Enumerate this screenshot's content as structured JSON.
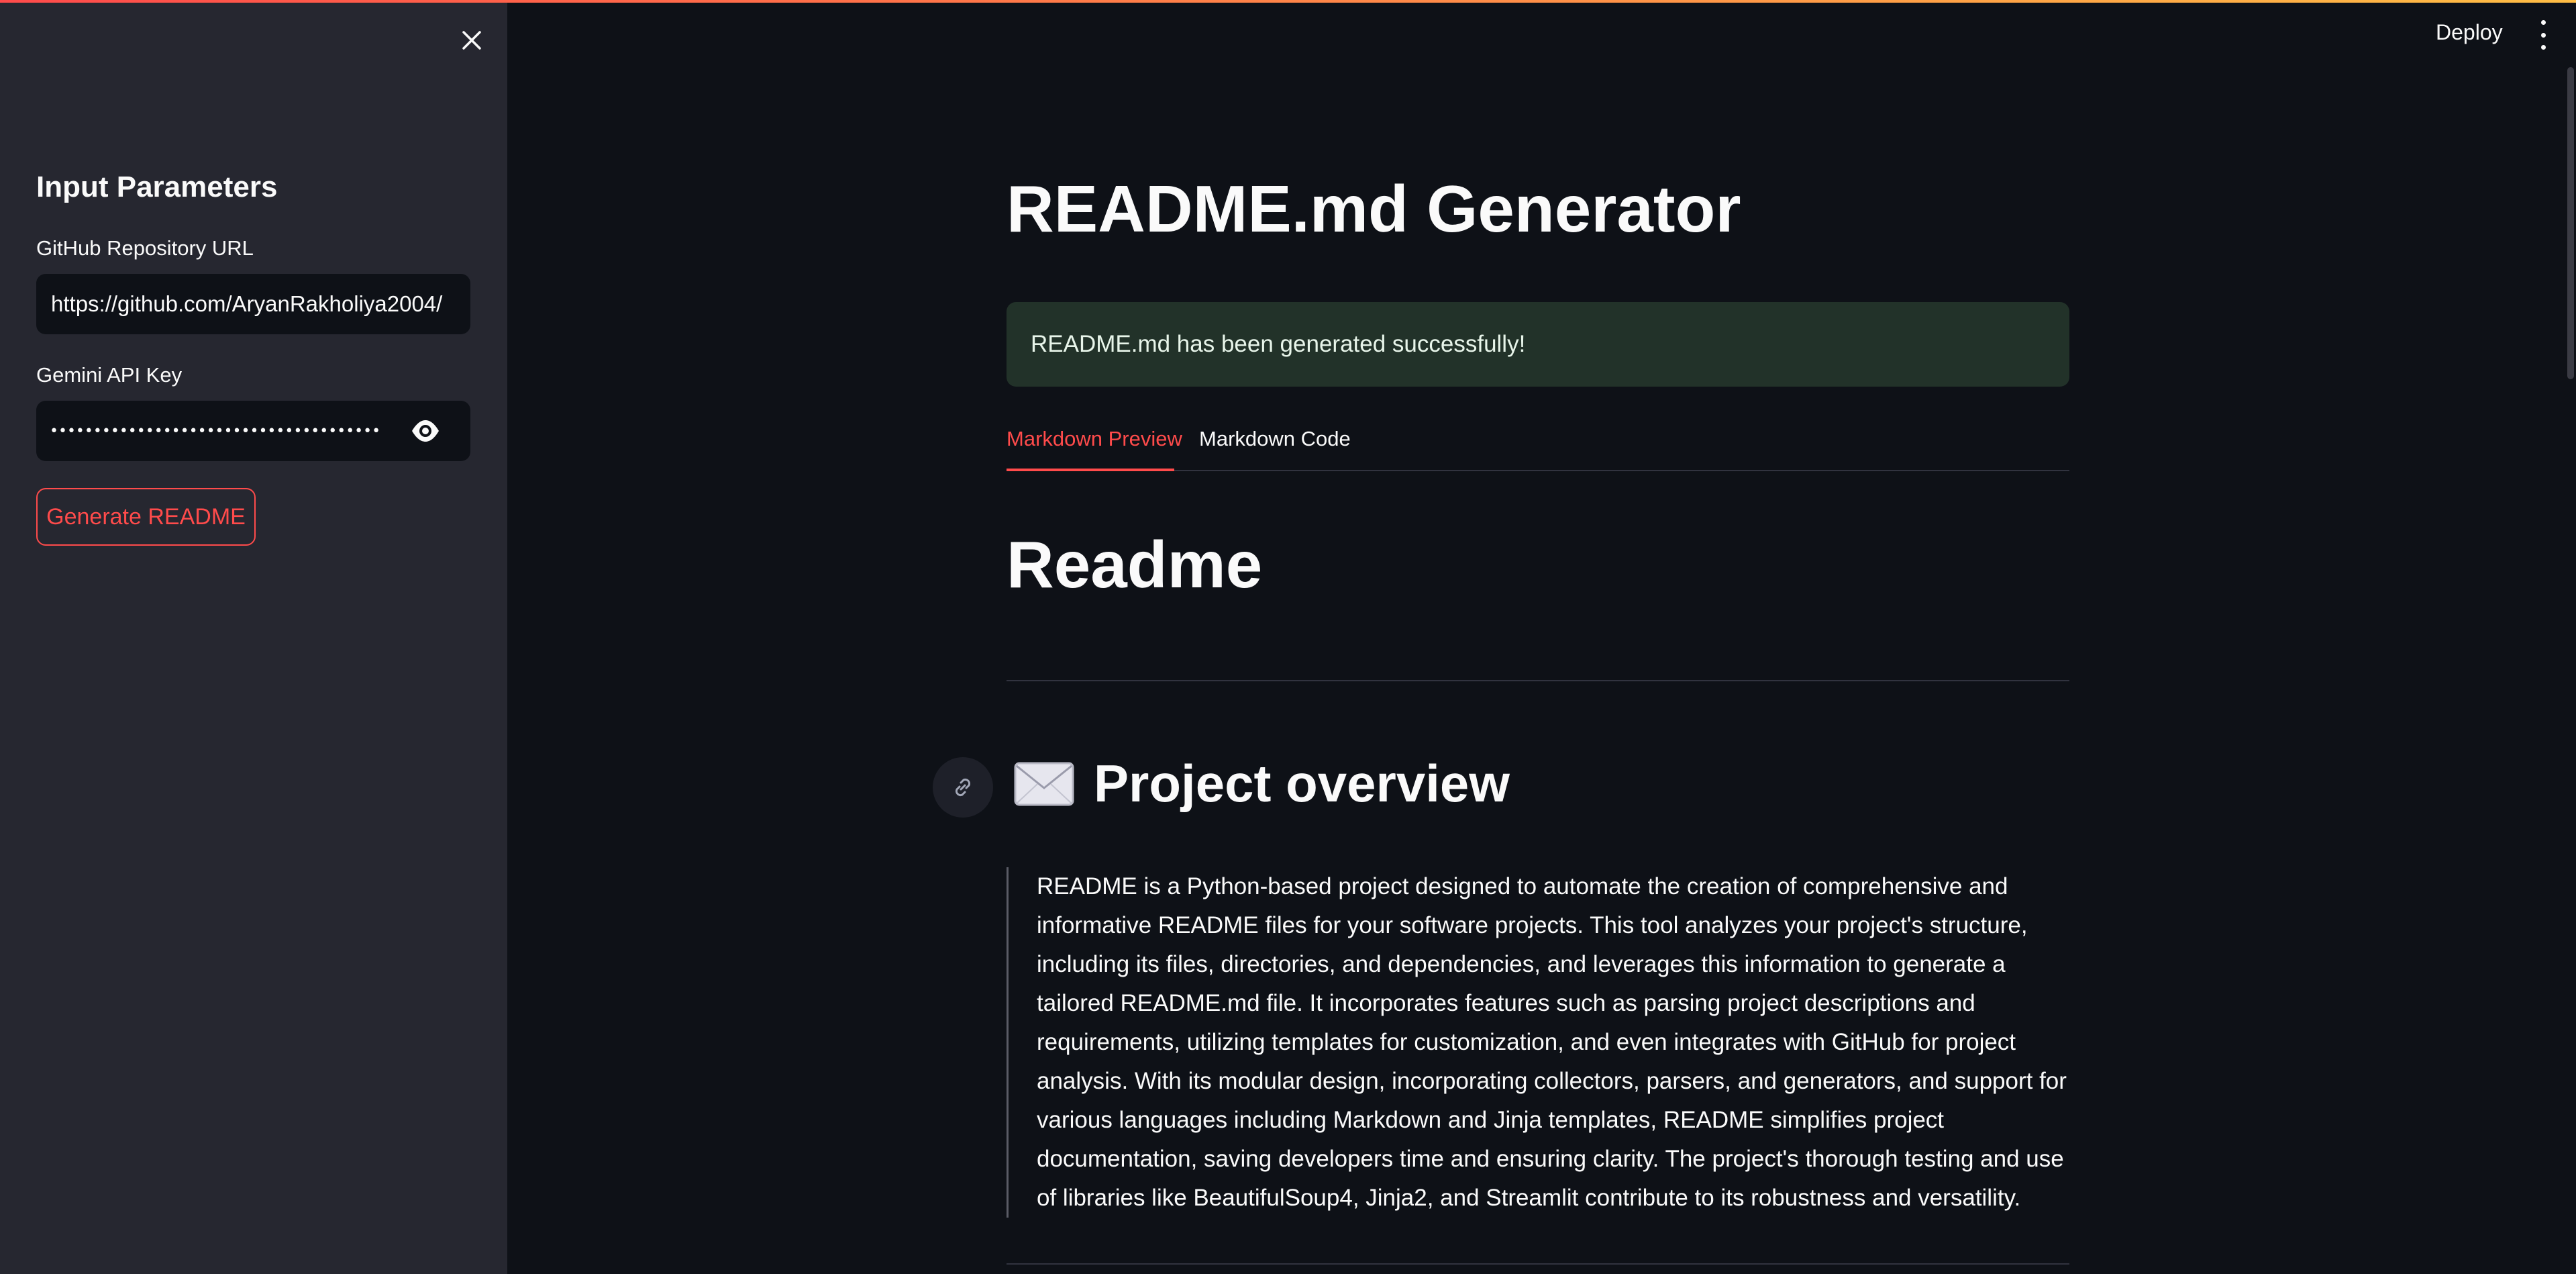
{
  "sidebar": {
    "title": "Input Parameters",
    "repo_label": "GitHub Repository URL",
    "repo_value": "https://github.com/AryanRakholiya2004/",
    "api_label": "Gemini API Key",
    "api_value_masked": "••••••••••••••••••••••••••••••••••••••",
    "generate_label": "Generate README"
  },
  "header": {
    "deploy_label": "Deploy"
  },
  "main": {
    "title": "README.md Generator",
    "success_message": "README.md has been generated successfully!",
    "tabs": [
      {
        "label": "Markdown Preview",
        "active": true
      },
      {
        "label": "Markdown Code",
        "active": false
      }
    ],
    "preview": {
      "heading": "Readme",
      "section_title": "Project overview",
      "section_icon": "envelope-icon",
      "paragraph": "README is a Python-based project designed to automate the creation of comprehensive and informative README files for your software projects. This tool analyzes your project's structure, including its files, directories, and dependencies, and leverages this information to generate a tailored README.md file. It incorporates features such as parsing project descriptions and requirements, utilizing templates for customization, and even integrates with GitHub for project analysis. With its modular design, incorporating collectors, parsers, and generators, and support for various languages including Markdown and Jinja templates, README simplifies project documentation, saving developers time and ensuring clarity. The project's thorough testing and use of libraries like BeautifulSoup4, Jinja2, and Streamlit contribute to its robustness and versatility."
    }
  },
  "colors": {
    "accent": "#ff4b4b",
    "background": "#0e1117",
    "sidebar": "#262730",
    "success_bg": "#223229"
  }
}
